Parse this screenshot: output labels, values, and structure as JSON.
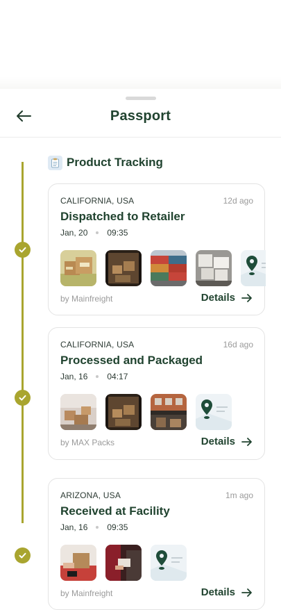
{
  "header": {
    "title": "Passport"
  },
  "section": {
    "title": "Product Tracking"
  },
  "events": [
    {
      "location": "CALIFORNIA, USA",
      "time_ago": "12d ago",
      "title": "Dispatched to Retailer",
      "date": "Jan, 20",
      "time": "09:35",
      "by": "by Mainfreight",
      "details_label": "Details",
      "thumbnails": [
        "boxes-photo",
        "truck-photo",
        "containers-photo",
        "warehouse-photo",
        "map-photo"
      ]
    },
    {
      "location": "CALIFORNIA, USA",
      "time_ago": "16d ago",
      "title": "Processed and Packaged",
      "date": "Jan, 16",
      "time": "04:17",
      "by": "by MAX Packs",
      "details_label": "Details",
      "thumbnails": [
        "packages-photo",
        "truck-photo",
        "storefront-photo",
        "map-photo"
      ]
    },
    {
      "location": "ARIZONA, USA",
      "time_ago": "1m ago",
      "title": "Received at Facility",
      "date": "Jan, 16",
      "time": "09:35",
      "by": "by Mainfreight",
      "details_label": "Details",
      "thumbnails": [
        "delivery-photo",
        "handover-photo",
        "map-photo"
      ]
    }
  ],
  "colors": {
    "accent": "#a9a52f",
    "title_green": "#20432f",
    "muted": "#9a9a9a",
    "card_border": "#e3e3e3"
  },
  "icons": {
    "back": "arrow-left-icon",
    "section": "clipboard-icon",
    "check": "check-icon",
    "details": "arrow-right-icon"
  }
}
